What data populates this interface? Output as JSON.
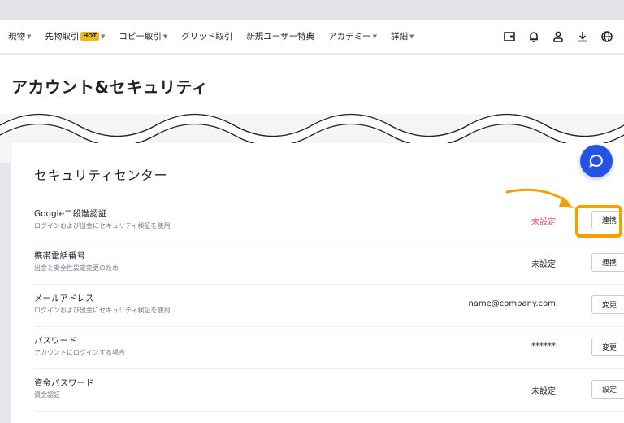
{
  "nav": {
    "items": [
      {
        "label": "現物",
        "caret": true
      },
      {
        "label": "先物取引",
        "badge": "HOT",
        "caret": true
      },
      {
        "label": "コピー取引",
        "caret": true
      },
      {
        "label": "グリッド取引",
        "caret": false
      },
      {
        "label": "新規ユーザー特典",
        "caret": false
      },
      {
        "label": "アカデミー",
        "caret": true
      },
      {
        "label": "詳細",
        "caret": true
      }
    ],
    "icons": [
      "wallet-icon",
      "bell-icon",
      "user-icon",
      "download-icon",
      "globe-icon"
    ]
  },
  "page": {
    "title": "アカウント&セキュリティ",
    "section_title": "セキュリティセンター"
  },
  "rows": [
    {
      "label": "Google二段階認証",
      "desc": "ログインおよび出金にセキュリティ検証を使用",
      "status": "未設定",
      "status_warn": true,
      "button": "連携"
    },
    {
      "label": "携帯電話番号",
      "desc": "出金と安全性設定変更のため",
      "status": "未設定",
      "status_warn": false,
      "button": "連携"
    },
    {
      "label": "メールアドレス",
      "desc": "ログインおよび出金にセキュリティ検証を使用",
      "status": "name@company.com",
      "status_warn": false,
      "button": "変更"
    },
    {
      "label": "パスワード",
      "desc": "アカウントにログインする場合",
      "status": "******",
      "status_warn": false,
      "button": "変更"
    },
    {
      "label": "資金パスワード",
      "desc": "資金認証",
      "status": "未設定",
      "status_warn": false,
      "button": "設定"
    }
  ],
  "colors": {
    "accent": "#f0b90b",
    "highlight": "#f5a000",
    "warn": "#f6465d",
    "fab": "#2354e6"
  }
}
